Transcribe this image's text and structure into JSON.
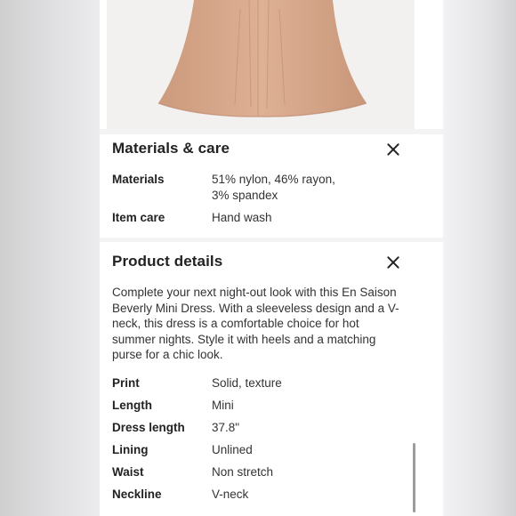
{
  "materials_care": {
    "title": "Materials & care",
    "rows": [
      {
        "label": "Materials",
        "value": "51% nylon, 46% rayon, 3% spandex"
      },
      {
        "label": "Item care",
        "value": "Hand wash"
      }
    ]
  },
  "product_details": {
    "title": "Product details",
    "description": "Complete your next night-out look with this En Saison Beverly Mini Dress. With a sleeveless design and a V-neck, this dress is a comfortable choice for hot summer nights. Style it with heels and a matching purse for a chic look.",
    "rows": [
      {
        "label": "Print",
        "value": "Solid, texture"
      },
      {
        "label": "Length",
        "value": "Mini"
      },
      {
        "label": "Dress length",
        "value": "37.8\""
      },
      {
        "label": "Lining",
        "value": "Unlined"
      },
      {
        "label": "Waist",
        "value": "Non stretch"
      },
      {
        "label": "Neckline",
        "value": "V-neck"
      }
    ]
  },
  "icons": {
    "close": "close-icon"
  },
  "colors": {
    "dress": "#d9a98c",
    "background": "#ffffff",
    "text": "#222222"
  }
}
